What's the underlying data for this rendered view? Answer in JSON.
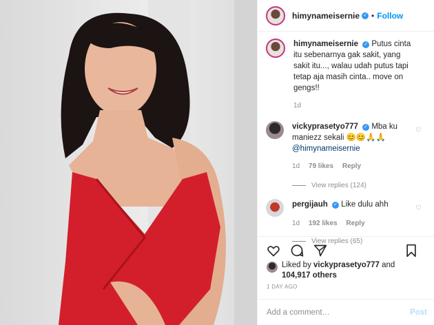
{
  "post": {
    "username": "himynameisernie",
    "follow_label": "Follow",
    "dot": "•",
    "caption": "Putus cinta itu sebenarnya gak sakit, yang sakit itu..., walau udah putus tapi tetap aja masih cinta.. move on gengs!!",
    "caption_age": "1d",
    "likes_prefix": "Liked by ",
    "likes_user": "vickyprasetyo777",
    "likes_and": " and",
    "likes_count": "104,917 others",
    "date": "1 DAY AGO",
    "add_comment_placeholder": "Add a comment…",
    "post_label": "Post"
  },
  "comments": [
    {
      "username": "vickyprasetyo777",
      "text": "Mba ku maniezz sekali 😊😊🙏🙏",
      "mention": "@himynameisernie",
      "age": "1d",
      "likes": "79 likes",
      "reply": "Reply",
      "view_replies": "View replies (124)"
    },
    {
      "username": "pergijauh",
      "text": "Like dulu ahh",
      "age": "1d",
      "likes": "192 likes",
      "reply": "Reply",
      "view_replies": "View replies (65)"
    }
  ],
  "icons": [
    "heart-icon",
    "comment-icon",
    "share-icon",
    "bookmark-icon",
    "verified-badge-icon"
  ],
  "colors": {
    "follow": "#0095f6",
    "dress": "#d31f2b",
    "verified": "#3897f0"
  }
}
